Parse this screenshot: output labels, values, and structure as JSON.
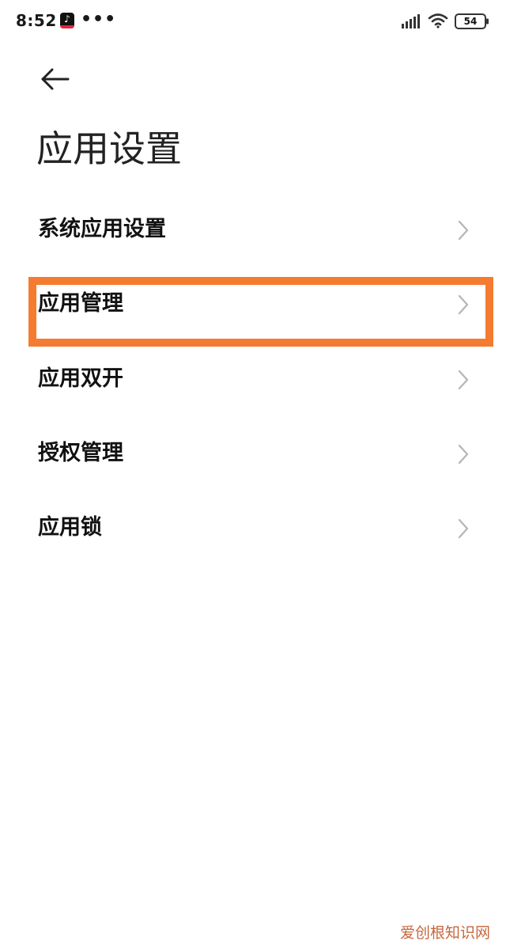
{
  "status_bar": {
    "time": "8:52",
    "battery": "54",
    "more": "•••",
    "tiktok_glyph": "♪"
  },
  "page": {
    "title": "应用设置"
  },
  "menu": {
    "items": [
      {
        "label": "系统应用设置"
      },
      {
        "label": "应用管理",
        "highlighted": true
      },
      {
        "label": "应用双开"
      },
      {
        "label": "授权管理"
      },
      {
        "label": "应用锁"
      }
    ]
  },
  "colors": {
    "highlight": "#f47b30",
    "chevron": "#b5b5b5",
    "watermark": "#c7673c"
  },
  "watermark": {
    "text": "爱创根知识网"
  },
  "icons": {
    "back": "arrow-left-icon",
    "chevron": "chevron-right-icon",
    "signal": "signal-icon",
    "wifi": "wifi-icon",
    "battery": "battery-icon",
    "tiktok": "tiktok-icon"
  }
}
